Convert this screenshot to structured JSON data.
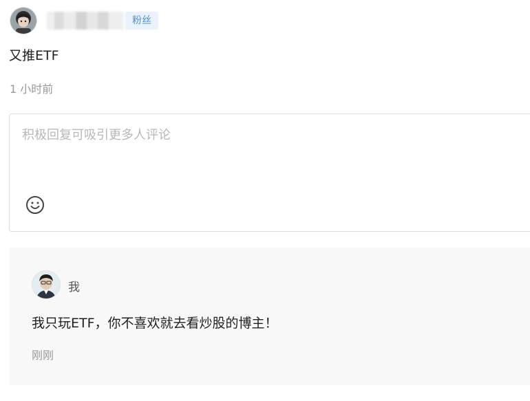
{
  "post": {
    "fan_badge": "粉丝",
    "text": "又推ETF",
    "time": "1 小时前"
  },
  "reply": {
    "placeholder": "积极回复可吸引更多人评论",
    "emoji_icon": "smiley-face-icon"
  },
  "comment": {
    "author": "我",
    "text": "我只玩ETF，你不喜欢就去看炒股的博主！",
    "time": "刚刚"
  }
}
